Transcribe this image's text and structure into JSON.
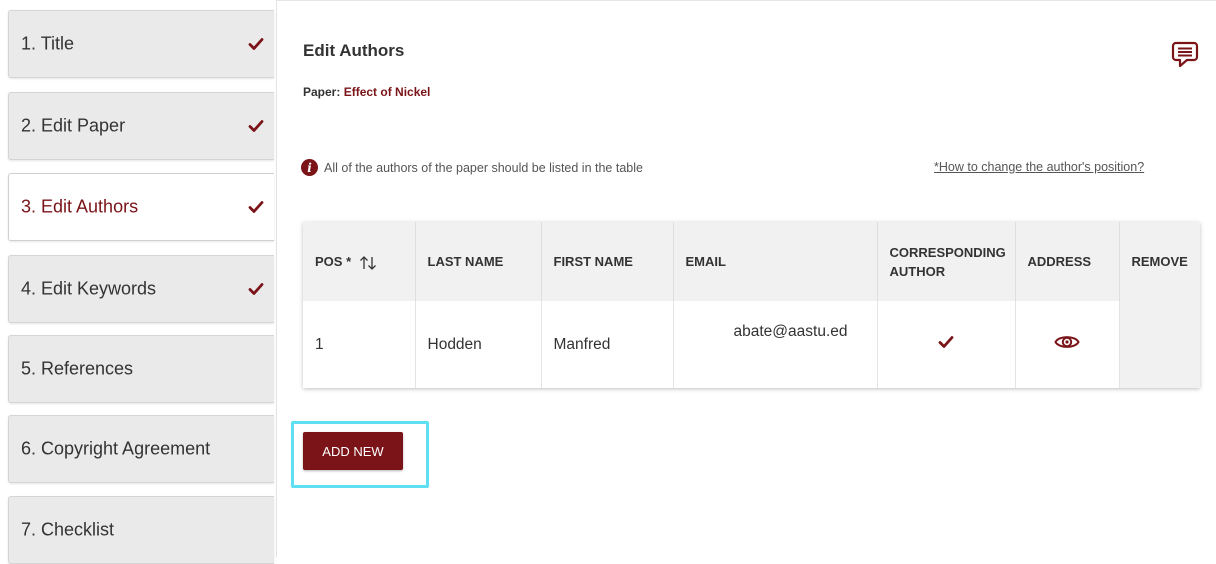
{
  "colors": {
    "accent": "#7a1418",
    "focus_ring": "#5fe0f0",
    "step_bg": "#eaeaea"
  },
  "sidebar": {
    "steps": [
      {
        "label": "1. Title",
        "completed": true,
        "active": false
      },
      {
        "label": "2. Edit Paper",
        "completed": true,
        "active": false
      },
      {
        "label": "3. Edit Authors",
        "completed": true,
        "active": true
      },
      {
        "label": "4. Edit Keywords",
        "completed": true,
        "active": false
      },
      {
        "label": "5. References",
        "completed": false,
        "active": false
      },
      {
        "label": "6. Copyright Agreement",
        "completed": false,
        "active": false
      },
      {
        "label": "7. Checklist",
        "completed": false,
        "active": false
      }
    ]
  },
  "main": {
    "title": "Edit Authors",
    "paper_label": "Paper:",
    "paper_name": "Effect of Nickel",
    "info_text": "All of the authors of the paper should be listed in the table",
    "help_link": "*How to change the author's position?",
    "add_button": "ADD NEW"
  },
  "table": {
    "headers": {
      "pos": "POS *",
      "last_name": "LAST NAME",
      "first_name": "FIRST NAME",
      "email": "EMAIL",
      "corresponding_author": "CORRESPONDING AUTHOR",
      "address": "ADDRESS",
      "remove": "REMOVE"
    },
    "rows": [
      {
        "pos": "1",
        "last_name": "Hodden",
        "first_name": "Manfred",
        "email": "abate@aastu.ed",
        "corresponding": true
      }
    ]
  }
}
